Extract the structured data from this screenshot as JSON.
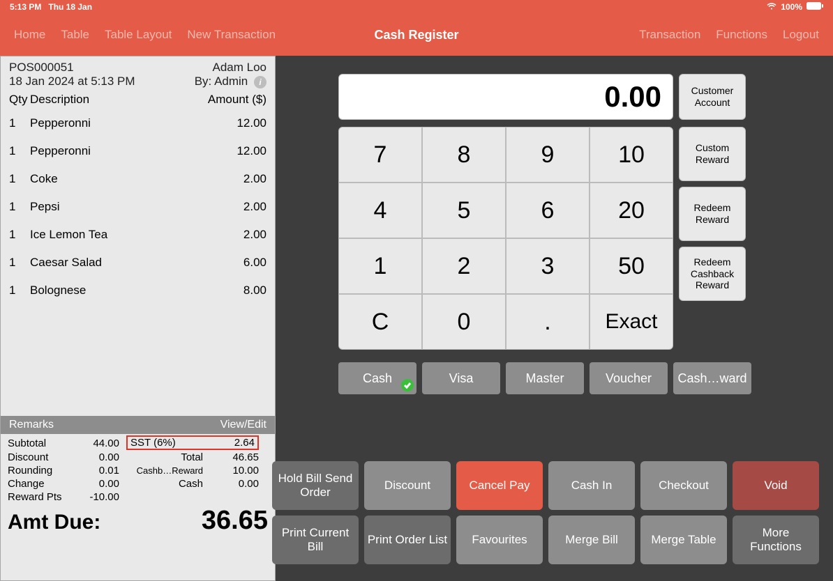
{
  "status": {
    "time": "5:13 PM",
    "date": "Thu 18 Jan",
    "battery": "100%"
  },
  "header": {
    "title": "Cash Register",
    "left": [
      "Home",
      "Table",
      "Table Layout",
      "New Transaction"
    ],
    "right": [
      "Transaction",
      "Functions",
      "Logout"
    ]
  },
  "receipt": {
    "pos_id": "POS000051",
    "customer": "Adam Loo",
    "datetime": "18 Jan 2024 at 5:13 PM",
    "by": "By: Admin",
    "col_qty": "Qty",
    "col_desc": "Description",
    "col_amt": "Amount ($)",
    "items": [
      {
        "qty": "1",
        "desc": "Pepperonni",
        "amt": "12.00"
      },
      {
        "qty": "1",
        "desc": "Pepperonni",
        "amt": "12.00"
      },
      {
        "qty": "1",
        "desc": "Coke",
        "amt": "2.00"
      },
      {
        "qty": "1",
        "desc": "Pepsi",
        "amt": "2.00"
      },
      {
        "qty": "1",
        "desc": "Ice Lemon Tea",
        "amt": "2.00"
      },
      {
        "qty": "1",
        "desc": "Caesar Salad",
        "amt": "6.00"
      },
      {
        "qty": "1",
        "desc": "Bolognese",
        "amt": "8.00"
      }
    ],
    "remarks_label": "Remarks",
    "remarks_action": "View/Edit",
    "totals": {
      "subtotal_l": "Subtotal",
      "subtotal_v": "44.00",
      "sst_l": "SST (6%)",
      "sst_v": "2.64",
      "discount_l": "Discount",
      "discount_v": "0.00",
      "total_l": "Total",
      "total_v": "46.65",
      "rounding_l": "Rounding",
      "rounding_v": "0.01",
      "cashb_l": "Cashb…Reward",
      "cashb_v": "10.00",
      "change_l": "Change",
      "change_v": "0.00",
      "cash_l": "Cash",
      "cash_v": "0.00",
      "pts_l": "Reward Pts",
      "pts_v": "-10.00"
    },
    "amt_due_l": "Amt Due:",
    "amt_due_v": "36.65"
  },
  "keypad": {
    "display": "0.00",
    "side": [
      "Customer Account",
      "Custom Reward",
      "Redeem Reward",
      "Redeem Cashback Reward"
    ],
    "keys": [
      "7",
      "8",
      "9",
      "10",
      "4",
      "5",
      "6",
      "20",
      "1",
      "2",
      "3",
      "50",
      "C",
      "0",
      ".",
      "Exact"
    ],
    "pay": [
      "Cash",
      "Visa",
      "Master",
      "Voucher",
      "Cash…ward"
    ],
    "pay_selected": 0
  },
  "actions": [
    {
      "label": "Hold Bill Send Order",
      "style": "dark"
    },
    {
      "label": "Discount",
      "style": ""
    },
    {
      "label": "Cancel Pay",
      "style": "red"
    },
    {
      "label": "Cash In",
      "style": ""
    },
    {
      "label": "Checkout",
      "style": ""
    },
    {
      "label": "Void",
      "style": "darkred"
    },
    {
      "label": "Print Current Bill",
      "style": "dark"
    },
    {
      "label": "Print Order List",
      "style": "dark"
    },
    {
      "label": "Favourites",
      "style": ""
    },
    {
      "label": "Merge Bill",
      "style": ""
    },
    {
      "label": "Merge Table",
      "style": ""
    },
    {
      "label": "More Functions",
      "style": "dark"
    }
  ]
}
